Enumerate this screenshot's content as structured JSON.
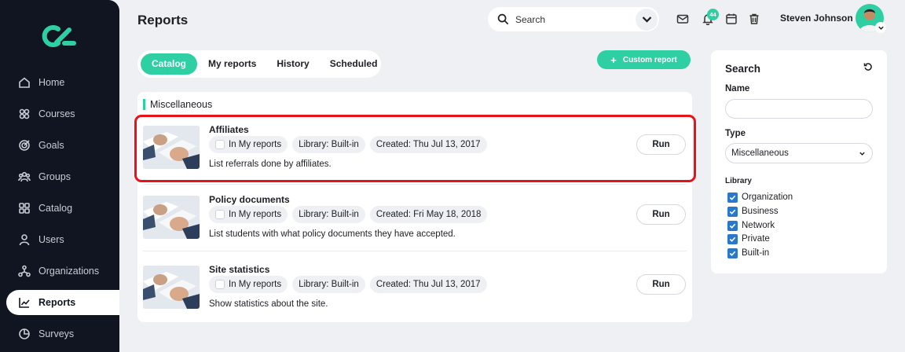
{
  "app": {
    "page_title": "Reports"
  },
  "header": {
    "search_placeholder": "Search",
    "notification_count": "44",
    "user_name": "Steven Johnson"
  },
  "sidebar": {
    "items": [
      {
        "label": "Home",
        "icon": "home-icon"
      },
      {
        "label": "Courses",
        "icon": "courses-icon"
      },
      {
        "label": "Goals",
        "icon": "goals-icon"
      },
      {
        "label": "Groups",
        "icon": "groups-icon"
      },
      {
        "label": "Catalog",
        "icon": "catalog-icon"
      },
      {
        "label": "Users",
        "icon": "users-icon"
      },
      {
        "label": "Organizations",
        "icon": "organizations-icon"
      },
      {
        "label": "Reports",
        "icon": "reports-icon",
        "active": true
      },
      {
        "label": "Surveys",
        "icon": "surveys-icon"
      }
    ]
  },
  "tabs": [
    {
      "label": "Catalog",
      "active": true
    },
    {
      "label": "My reports"
    },
    {
      "label": "History"
    },
    {
      "label": "Scheduled"
    }
  ],
  "custom_report_label": "Custom report",
  "section_title": "Miscellaneous",
  "reports": [
    {
      "title": "Affiliates",
      "in_my_reports_label": "In My reports",
      "library": "Library: Built-in",
      "created": "Created: Thu Jul 13, 2017",
      "description": "List referrals done by affiliates.",
      "run_label": "Run"
    },
    {
      "title": "Policy documents",
      "in_my_reports_label": "In My reports",
      "library": "Library: Built-in",
      "created": "Created: Fri May 18, 2018",
      "description": "List students with what policy documents they have accepted.",
      "run_label": "Run"
    },
    {
      "title": "Site statistics",
      "in_my_reports_label": "In My reports",
      "library": "Library: Built-in",
      "created": "Created: Thu Jul 13, 2017",
      "description": "Show statistics about the site.",
      "run_label": "Run"
    }
  ],
  "search_panel": {
    "title": "Search",
    "name_label": "Name",
    "name_value": "",
    "type_label": "Type",
    "type_value": "Miscellaneous",
    "library_label": "Library",
    "library_options": [
      {
        "label": "Organization",
        "checked": true
      },
      {
        "label": "Business",
        "checked": true
      },
      {
        "label": "Network",
        "checked": true
      },
      {
        "label": "Private",
        "checked": true
      },
      {
        "label": "Built-in",
        "checked": true
      }
    ]
  },
  "colors": {
    "accent": "#2ecfa3",
    "sidebar_bg": "#111522",
    "highlight": "#e8121b",
    "checkbox": "#2b78c9"
  }
}
